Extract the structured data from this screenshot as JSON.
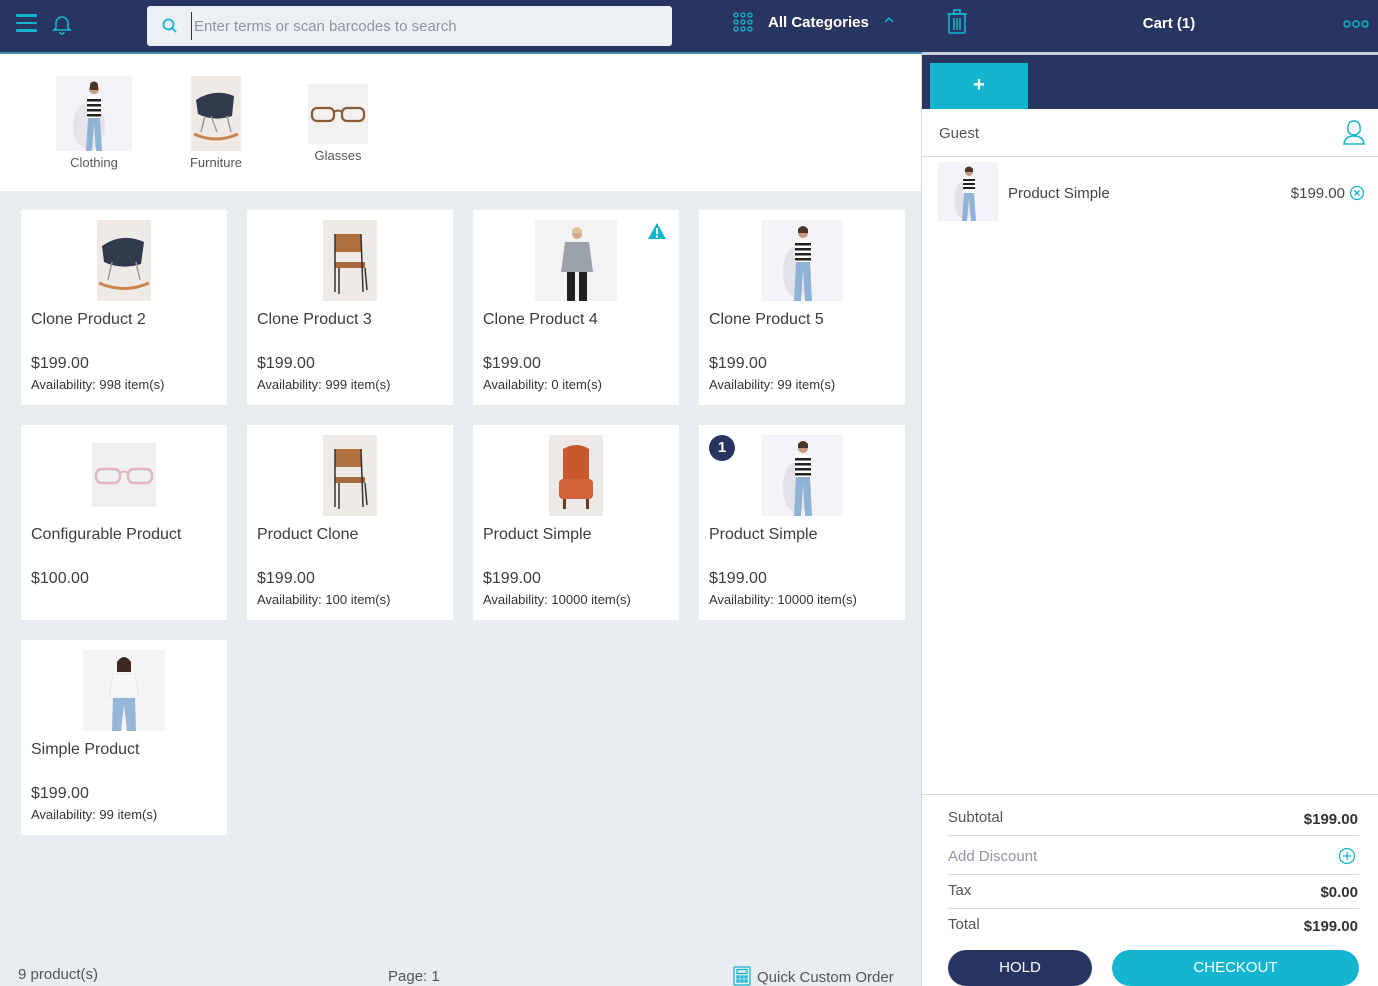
{
  "header": {
    "search_placeholder": "Enter terms or scan barcodes to search",
    "category_label": "All Categories",
    "cart_title": "Cart (1)"
  },
  "categories": [
    {
      "label": "Clothing",
      "icon": "clothing-photo"
    },
    {
      "label": "Furniture",
      "icon": "chair-photo"
    },
    {
      "label": "Glasses",
      "icon": "glasses-photo"
    }
  ],
  "products": [
    {
      "name": "Clone Product 2",
      "price": "$199.00",
      "availability": "Availability: 998 item(s)",
      "image": "rocking-chair-photo"
    },
    {
      "name": "Clone Product 3",
      "price": "$199.00",
      "availability": "Availability: 999 item(s)",
      "image": "wooden-chair-photo"
    },
    {
      "name": "Clone Product 4",
      "price": "$199.00",
      "availability": "Availability: 0 item(s)",
      "image": "grey-sweater-photo",
      "warning": true
    },
    {
      "name": "Clone Product 5",
      "price": "$199.00",
      "availability": "Availability: 99 item(s)",
      "image": "striped-top-photo"
    },
    {
      "name": "Configurable Product",
      "price": "$100.00",
      "availability": "",
      "image": "pink-glasses-photo"
    },
    {
      "name": "Product Clone",
      "price": "$199.00",
      "availability": "Availability: 100 item(s)",
      "image": "wooden-chair-photo"
    },
    {
      "name": "Product Simple",
      "price": "$199.00",
      "availability": "Availability: 10000 item(s)",
      "image": "orange-armchair-photo"
    },
    {
      "name": "Product Simple",
      "price": "$199.00",
      "availability": "Availability: 10000 item(s)",
      "image": "striped-top-photo",
      "badge": "1"
    },
    {
      "name": "Simple Product",
      "price": "$199.00",
      "availability": "Availability: 99 item(s)",
      "image": "white-blouse-photo"
    }
  ],
  "footer": {
    "product_count": "9 product(s)",
    "page": "Page: 1",
    "quick_custom_order": "Quick Custom Order"
  },
  "cart": {
    "add_tab": "+",
    "customer": "Guest",
    "items": [
      {
        "name": "Product Simple",
        "price": "$199.00"
      }
    ],
    "subtotal_label": "Subtotal",
    "subtotal": "$199.00",
    "discount_label": "Add Discount",
    "tax_label": "Tax",
    "tax": "$0.00",
    "total_label": "Total",
    "total": "$199.00",
    "hold_label": "HOLD",
    "checkout_label": "CHECKOUT"
  },
  "colors": {
    "navy": "#283560",
    "accent": "#13b5d1",
    "background": "#e9ecf1"
  }
}
